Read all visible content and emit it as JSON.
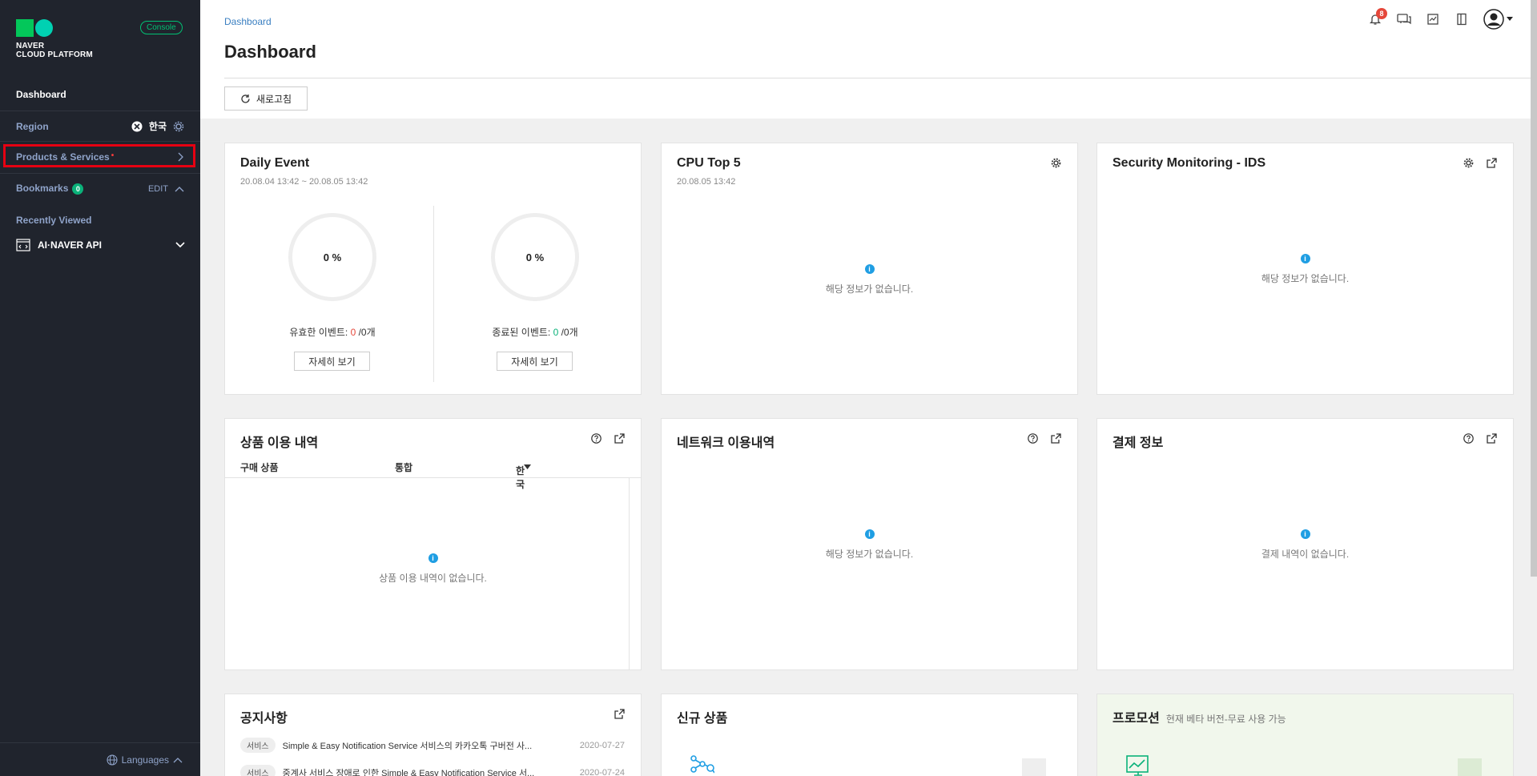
{
  "sidebar": {
    "logo_text_1": "NAVER",
    "logo_text_2": "CLOUD PLATFORM",
    "console_label": "Console",
    "dashboard_label": "Dashboard",
    "region_label": "Region",
    "region_value": "한국",
    "products_label": "Products & Services",
    "products_dot": "•",
    "bookmarks_label": "Bookmarks",
    "bookmarks_count": "0",
    "edit_label": "EDIT",
    "recent_label": "Recently Viewed",
    "recent_item": "AI·NAVER API",
    "languages_label": "Languages"
  },
  "header": {
    "breadcrumb": "Dashboard",
    "title": "Dashboard",
    "refresh_label": "새로고침",
    "notification_count": "8"
  },
  "daily_event": {
    "title": "Daily Event",
    "range": "20.08.04 13:42 ~ 20.08.05 13:42",
    "left_percent": "0 %",
    "right_percent": "0 %",
    "left_label": "유효한 이벤트: ",
    "left_zero": "0",
    "left_total": " /0개",
    "right_label": "종료된 이벤트: ",
    "right_zero": "0",
    "right_total": " /0개",
    "detail_label": "자세히 보기"
  },
  "cpu": {
    "title": "CPU Top 5",
    "time": "20.08.05 13:42",
    "empty": "해당 정보가 없습니다."
  },
  "security": {
    "title": "Security Monitoring - IDS",
    "empty": "해당 정보가 없습니다."
  },
  "usage": {
    "title": "상품 이용 내역",
    "col1": "구매 상품",
    "col2": "통합",
    "col3": "한국",
    "empty": "상품 이용 내역이 없습니다."
  },
  "network": {
    "title": "네트워크 이용내역",
    "empty": "해당 정보가 없습니다."
  },
  "billing": {
    "title": "결제 정보",
    "empty": "결제 내역이 없습니다."
  },
  "notice": {
    "title": "공지사항",
    "items": [
      {
        "tag": "서비스",
        "text": "Simple & Easy Notification Service 서비스의 카카오톡 구버전 사...",
        "date": "2020-07-27"
      },
      {
        "tag": "서비스",
        "text": "중계사 서비스 장애로 인한 Simple & Easy Notification Service 서...",
        "date": "2020-07-24"
      }
    ]
  },
  "new_products": {
    "title": "신규 상품"
  },
  "promotion": {
    "title": "프로모션",
    "subtitle": "현재 베타 버전-무료 사용 가능"
  },
  "colors": {
    "sidebar_bg": "#20242d",
    "accent_green": "#03c75a",
    "link_blue": "#3a7fc1",
    "highlight_red": "#e60012"
  }
}
